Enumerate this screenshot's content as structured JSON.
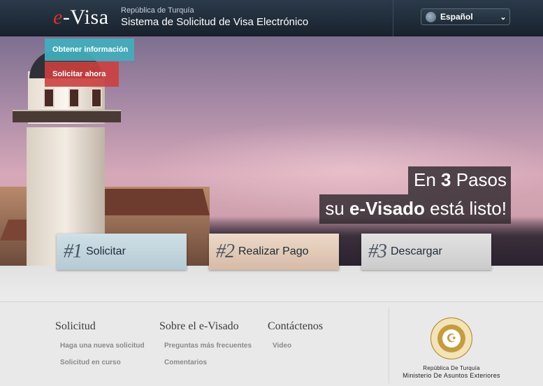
{
  "header": {
    "logo_e": "e",
    "logo_visa": "-Visa",
    "subtitle": "República de Turquía",
    "title": "Sistema de Solicitud de Visa Electrónico",
    "language": "Español"
  },
  "hero_menu": {
    "info": "Obtener información",
    "apply": "Solicitar ahora"
  },
  "hero": {
    "line1_a": "En ",
    "line1_b": "3",
    "line1_c": " Pasos",
    "line2_a": "su ",
    "line2_b": "e-Visado",
    "line2_c": " está listo!"
  },
  "steps": [
    {
      "num": "#1",
      "label": "Solicitar"
    },
    {
      "num": "#2",
      "label": "Realizar Pago"
    },
    {
      "num": "#3",
      "label": "Descargar"
    }
  ],
  "footer": {
    "columns": [
      {
        "title": "Solicitud",
        "links": [
          "Haga una nueva solicitud",
          "Solicitud en curso"
        ]
      },
      {
        "title": "Sobre el e-Visado",
        "links": [
          "Preguntas más frecuentes",
          "Comentarios"
        ]
      },
      {
        "title": "Contáctenos",
        "links": [
          "Video"
        ]
      }
    ],
    "ministry_line1": "República De Turquía",
    "ministry_line2": "Ministerio De Asuntos Exteriores"
  },
  "colors": {
    "header_bg": "#1f2b37",
    "info_button": "#40afbe",
    "apply_button": "#cc3f3f",
    "seal_gold": "#c69c3b"
  }
}
